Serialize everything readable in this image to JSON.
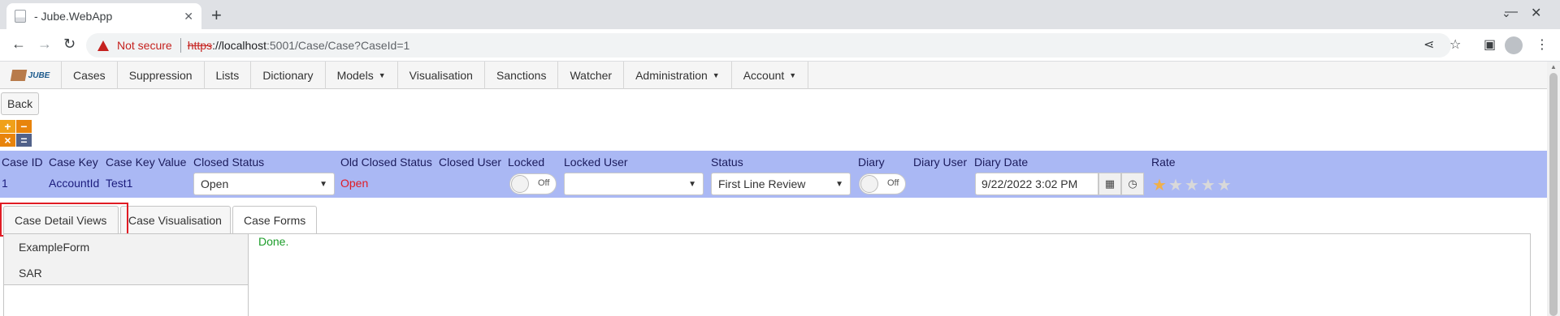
{
  "browser": {
    "tab_title": "- Jube.WebApp",
    "new_tab": "+",
    "close_tab": "✕",
    "not_secure": "Not secure",
    "url_scheme": "https",
    "url_host": "://localhost",
    "url_rest": ":5001/Case/Case?CaseId=1"
  },
  "nav": {
    "logo_text": "JUBE",
    "items": [
      {
        "label": "Cases",
        "caret": false
      },
      {
        "label": "Suppression",
        "caret": false
      },
      {
        "label": "Lists",
        "caret": false
      },
      {
        "label": "Dictionary",
        "caret": false
      },
      {
        "label": "Models",
        "caret": true
      },
      {
        "label": "Visualisation",
        "caret": false
      },
      {
        "label": "Sanctions",
        "caret": false
      },
      {
        "label": "Watcher",
        "caret": false
      },
      {
        "label": "Administration",
        "caret": true
      },
      {
        "label": "Account",
        "caret": true
      }
    ]
  },
  "back_label": "Back",
  "calc": {
    "plus": "+",
    "minus": "−",
    "times": "×",
    "equals": "="
  },
  "case": {
    "headers": {
      "case_id": "Case ID",
      "case_key": "Case Key",
      "case_key_value": "Case Key Value",
      "closed_status": "Closed Status",
      "old_closed_status": "Old Closed Status",
      "closed_user": "Closed User",
      "locked": "Locked",
      "locked_user": "Locked User",
      "status": "Status",
      "diary": "Diary",
      "diary_user": "Diary User",
      "diary_date": "Diary Date",
      "rate": "Rate"
    },
    "values": {
      "case_id": "1",
      "case_key": "AccountId",
      "case_key_value": "Test1",
      "closed_status": "Open",
      "old_closed_status": "Open",
      "locked": "Off",
      "locked_user": "",
      "status": "First Line Review",
      "diary": "Off",
      "diary_date": "9/22/2022 3:02 PM",
      "rating": 1,
      "rating_max": 5
    }
  },
  "tabs": [
    "Case Detail Views",
    "Case Visualisation",
    "Case Forms"
  ],
  "active_tab": "Case Forms",
  "forms": [
    "ExampleForm",
    "SAR"
  ],
  "status_message": "Done.",
  "colors": {
    "header_band": "#aab8f4",
    "old_status": "#e01b24",
    "done": "#1c9d2a",
    "highlight": "#e01b24"
  }
}
